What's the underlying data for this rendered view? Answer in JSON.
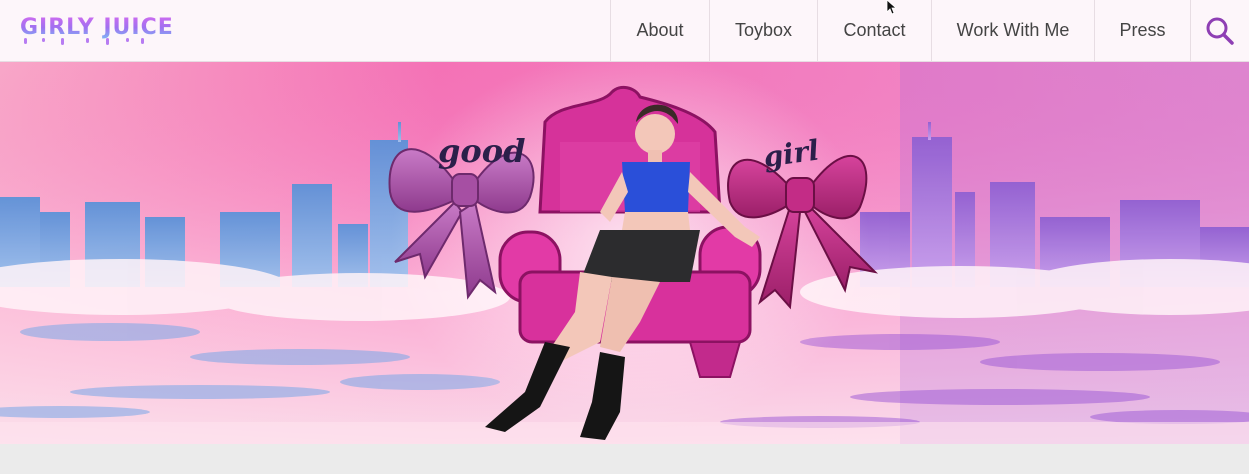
{
  "header": {
    "logo_text": "GIRLY JUICE",
    "nav": [
      {
        "label": "About"
      },
      {
        "label": "Toybox"
      },
      {
        "label": "Contact"
      },
      {
        "label": "Work With Me"
      },
      {
        "label": "Press"
      }
    ],
    "search_icon": "search-icon"
  },
  "hero": {
    "bow_left_text": "good",
    "bow_right_text": "girl"
  },
  "colors": {
    "accent": "#8e3fb4",
    "hero_pink": "#f46fb8",
    "hero_purple": "#9b57d6",
    "hero_blue": "#7aa7e8"
  }
}
